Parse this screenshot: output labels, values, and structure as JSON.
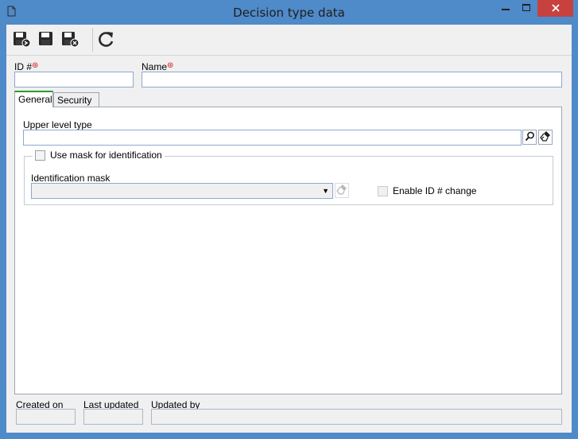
{
  "window": {
    "title": "Decision type data",
    "icons": {
      "doc": "document-icon",
      "min": "minimize-icon",
      "max": "maximize-icon",
      "close": "close-icon"
    },
    "close_color": "#c7413f"
  },
  "toolbar": {
    "buttons": [
      {
        "name": "save-new-button",
        "icon": "save-new-icon"
      },
      {
        "name": "save-button",
        "icon": "save-icon"
      },
      {
        "name": "save-close-button",
        "icon": "save-close-icon"
      },
      {
        "name": "refresh-button",
        "icon": "refresh-icon"
      }
    ]
  },
  "form": {
    "id_label": "ID #",
    "id_value": "",
    "name_label": "Name",
    "name_value": "",
    "required_marker": "⊛",
    "required_color": "#d41a1a"
  },
  "tabs": [
    {
      "label": "General",
      "active": true
    },
    {
      "label": "Security",
      "active": false
    }
  ],
  "general": {
    "upper_level_label": "Upper level type",
    "upper_level_value": "",
    "use_mask_label": "Use mask for identification",
    "use_mask_checked": false,
    "identification_mask_label": "Identification mask",
    "identification_mask_value": "",
    "enable_id_change_label": "Enable ID # change",
    "enable_id_change_checked": false
  },
  "footer": {
    "created_on_label": "Created on",
    "created_on_value": "",
    "last_updated_label": "Last updated",
    "last_updated_value": "",
    "updated_by_label": "Updated by",
    "updated_by_value": ""
  }
}
